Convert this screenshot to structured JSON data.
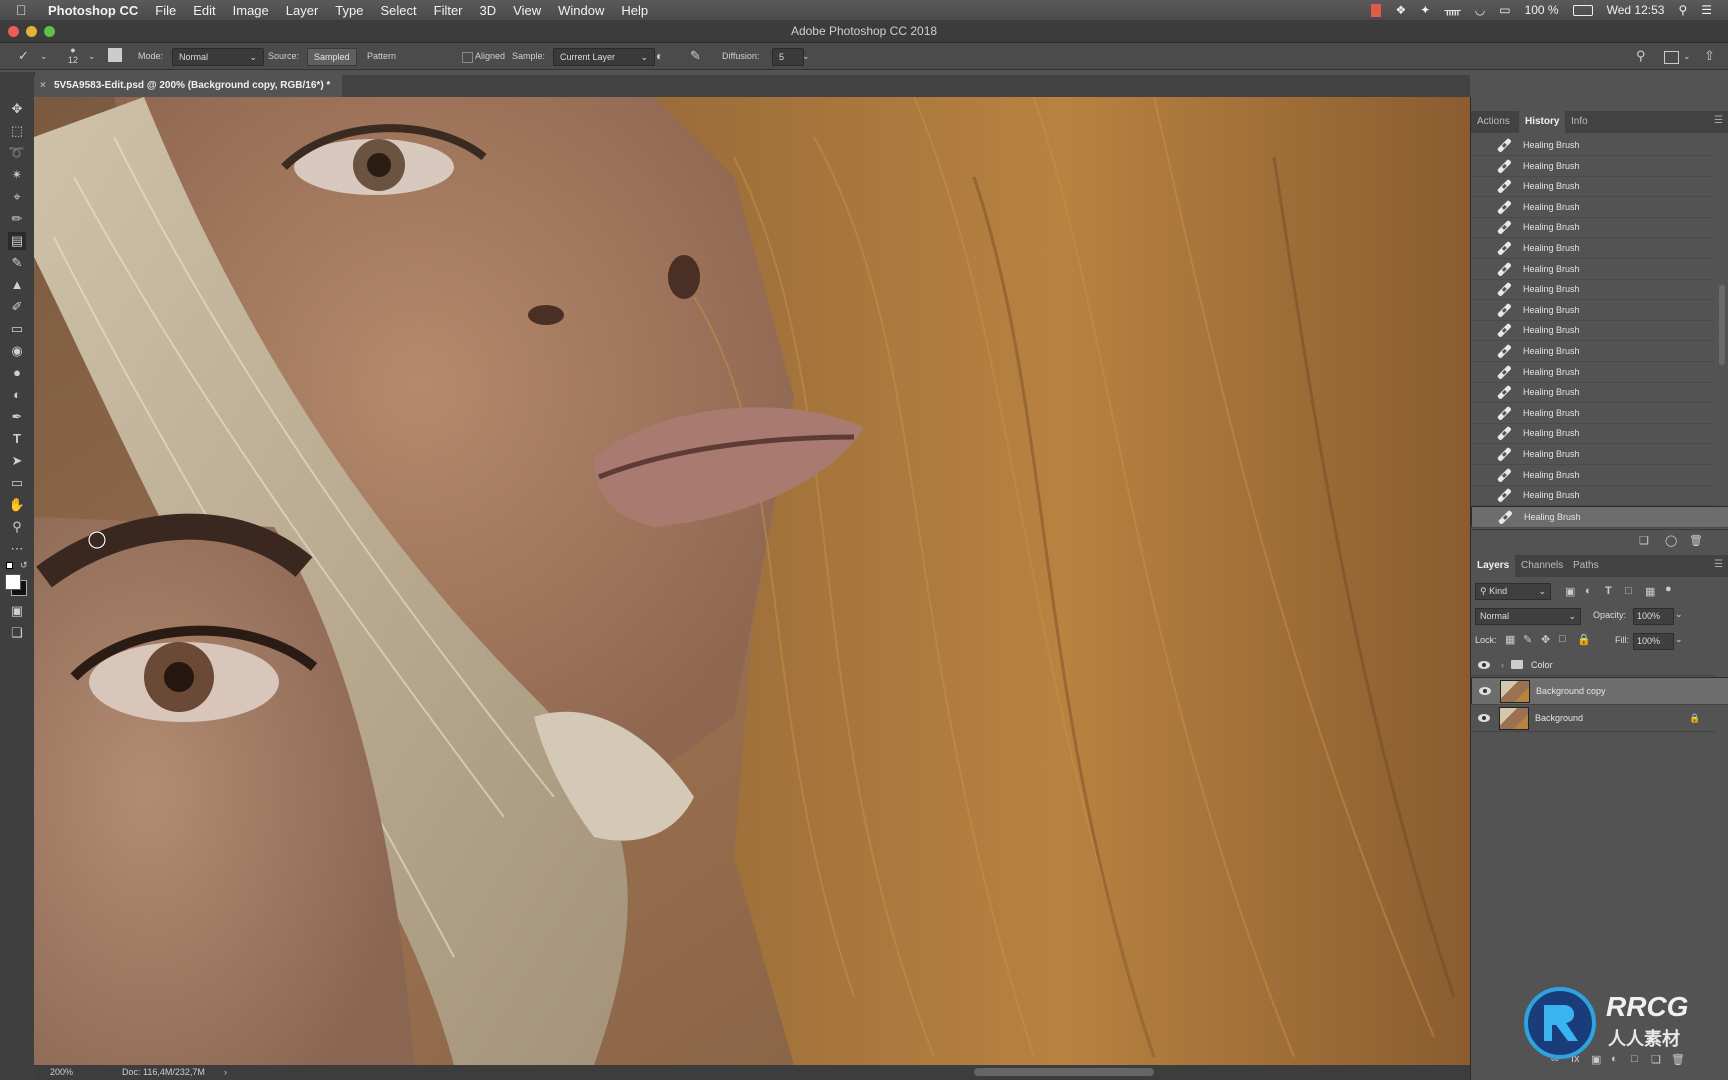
{
  "menubar": {
    "app_name": "Photoshop CC",
    "items": [
      "File",
      "Edit",
      "Image",
      "Layer",
      "Type",
      "Select",
      "Filter",
      "3D",
      "View",
      "Window",
      "Help"
    ],
    "battery": "100 %",
    "clock": "Wed 12:53"
  },
  "window": {
    "title": "Adobe Photoshop CC 2018"
  },
  "options": {
    "brush_size": "12",
    "mode_label": "Mode:",
    "mode_value": "Normal",
    "source_label": "Source:",
    "sampled": "Sampled",
    "pattern": "Pattern",
    "aligned": "Aligned",
    "sample_label": "Sample:",
    "sample_value": "Current Layer",
    "diffusion_label": "Diffusion:",
    "diffusion_value": "5"
  },
  "document": {
    "tab_title": "5V5A9583-Edit.psd @ 200% (Background copy, RGB/16*) *",
    "zoom": "200%",
    "doc_size": "Doc: 116,4M/232,7M"
  },
  "history_panel": {
    "tabs": [
      "Actions",
      "History",
      "Info"
    ],
    "active_tab": "History",
    "items": [
      "Healing Brush",
      "Healing Brush",
      "Healing Brush",
      "Healing Brush",
      "Healing Brush",
      "Healing Brush",
      "Healing Brush",
      "Healing Brush",
      "Healing Brush",
      "Healing Brush",
      "Healing Brush",
      "Healing Brush",
      "Healing Brush",
      "Healing Brush",
      "Healing Brush",
      "Healing Brush",
      "Healing Brush",
      "Healing Brush",
      "Healing Brush"
    ]
  },
  "layers_panel": {
    "tabs": [
      "Layers",
      "Channels",
      "Paths"
    ],
    "active_tab": "Layers",
    "kind_label": "Kind",
    "blend_mode": "Normal",
    "opacity_label": "Opacity:",
    "opacity_value": "100%",
    "lock_label": "Lock:",
    "fill_label": "Fill:",
    "fill_value": "100%",
    "layers": [
      {
        "name": "Color",
        "type": "group"
      },
      {
        "name": "Background copy",
        "type": "pixel",
        "selected": true
      },
      {
        "name": "Background",
        "type": "pixel",
        "locked": true
      }
    ]
  },
  "watermark": {
    "brand": "RRCG",
    "sub": "人人素材"
  }
}
